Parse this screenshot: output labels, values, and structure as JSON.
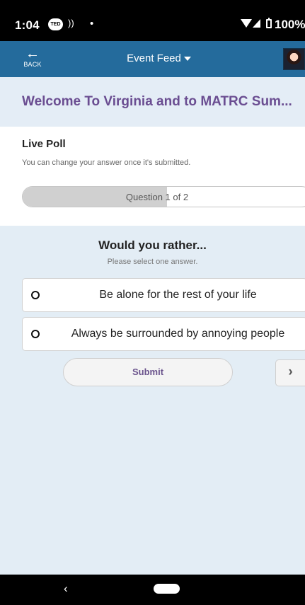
{
  "status_bar": {
    "time": "1:04",
    "notification_icon": "TED",
    "battery_text": "100%"
  },
  "app_bar": {
    "back_label": "BACK",
    "title": "Event Feed"
  },
  "welcome": {
    "title": "Welcome To Virginia and to MATRC Sum..."
  },
  "poll": {
    "title": "Live Poll",
    "subtitle": "You can change your answer once it's submitted.",
    "progress_label": "Question 1 of 2",
    "progress_fraction": 0.5
  },
  "question": {
    "text": "Would you rather...",
    "instruction": "Please select one answer."
  },
  "options": [
    {
      "label": "Be alone for the rest of your life"
    },
    {
      "label": "Always be surrounded by annoying people"
    }
  ],
  "actions": {
    "submit": "Submit"
  },
  "colors": {
    "app_bar": "#246b9c",
    "accent_purple": "#6a4d91",
    "poll_background": "#e3edf5"
  },
  "icons": {
    "back": "back-arrow-icon",
    "dropdown": "caret-down-icon",
    "next": "chevron-right-icon"
  }
}
